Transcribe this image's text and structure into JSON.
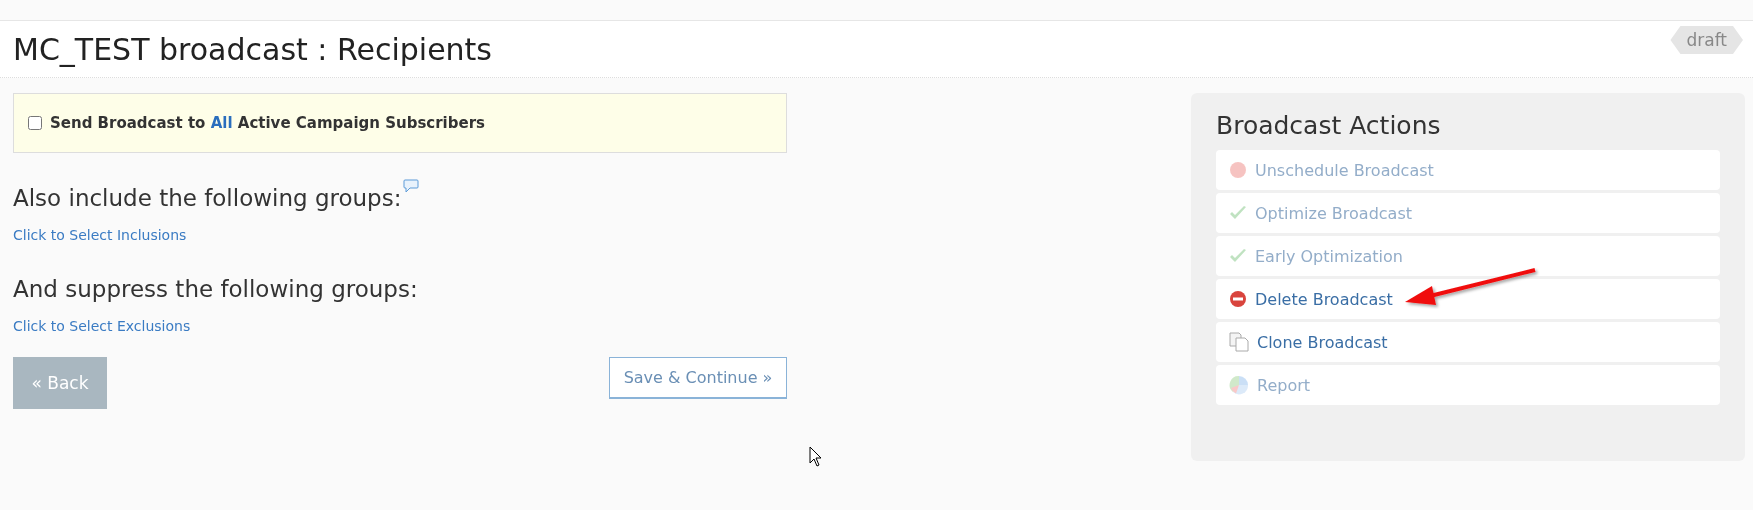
{
  "header": {
    "title": "MC_TEST broadcast : Recipients",
    "status_badge": "draft"
  },
  "send_all": {
    "checked": false,
    "label": "Send Broadcast to **All** Active Campaign Subscribers"
  },
  "inclusions": {
    "heading": "Also include the following groups:",
    "link": "Click to Select Inclusions"
  },
  "exclusions": {
    "heading": "And suppress the following groups:",
    "link": "Click to Select Exclusions"
  },
  "buttons": {
    "back": "« Back",
    "save": "Save & Continue »"
  },
  "actions": {
    "title": "Broadcast Actions",
    "items": [
      {
        "kind": "stop",
        "label": "Unschedule Broadcast",
        "disabled": true
      },
      {
        "kind": "check",
        "label": "Optimize Broadcast",
        "disabled": true
      },
      {
        "kind": "check",
        "label": "Early Optimization",
        "disabled": true
      },
      {
        "kind": "delete",
        "label": "Delete Broadcast",
        "disabled": false
      },
      {
        "kind": "clone",
        "label": "Clone Broadcast",
        "disabled": false
      },
      {
        "kind": "report",
        "label": "Report",
        "disabled": true
      }
    ]
  }
}
